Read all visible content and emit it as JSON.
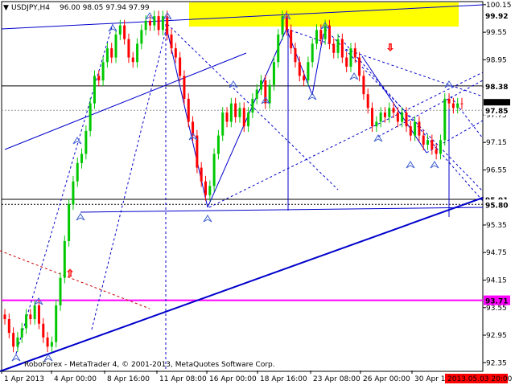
{
  "chart_data": {
    "type": "candlestick",
    "symbol_label": "USDJPY,H4",
    "ohlc_header": "96.00 98.05 97.94 97.99",
    "watermark": "RoboForex - MetaTrader 4, © 2001-2013, MetaQuotes Software Corp.",
    "ylim": [
      92.18,
      100.2
    ],
    "y_ticks": [
      100.15,
      99.55,
      98.95,
      98.35,
      97.75,
      97.15,
      96.55,
      95.95,
      95.35,
      94.75,
      94.15,
      93.55,
      92.95,
      92.35
    ],
    "x_ticks": [
      "1 Apr 2013",
      "4 Apr 00:00",
      "8 Apr 16:00",
      "11 Apr 08:00",
      "16 Apr 00:00",
      "18 Apr 16:00",
      "23 Apr 08:00",
      "26 Apr 00:00",
      "30 Apr 1"
    ],
    "last_time_label": "2013.05.03 20:00",
    "price_labels": [
      {
        "text": "99.92",
        "value": 99.92,
        "bg": "#ffffff",
        "fg": "#000000"
      },
      {
        "text": "98.38",
        "value": 98.38,
        "bg": "#ffffff",
        "fg": "#000000"
      },
      {
        "text": "97.99",
        "value": 97.99,
        "bg": "#000000",
        "fg": "#ffffff"
      },
      {
        "text": "97.85",
        "value": 97.85,
        "bg": "#ffffff",
        "fg": "#999999"
      },
      {
        "text": "95.91",
        "value": 95.91,
        "bg": "#ffffff",
        "fg": "#000000"
      },
      {
        "text": "95.80",
        "value": 95.8,
        "bg": "#ffffff",
        "fg": "#000000"
      },
      {
        "text": "93.71",
        "value": 93.71,
        "bg": "#ff00ff",
        "fg": "#ffffff"
      }
    ],
    "horizontal_levels": [
      {
        "value": 98.38,
        "color": "#000000"
      },
      {
        "value": 95.91,
        "color": "#000000"
      },
      {
        "value": 93.71,
        "color": "#ff00ff"
      }
    ],
    "colors": {
      "bull": "#00c800",
      "bear": "#ff0000",
      "trend": "#0000cc",
      "highlight": "#ffff00",
      "grid": "#dddddd"
    },
    "candles_note": "approximate close series",
    "closes": [
      93.3,
      93.0,
      92.7,
      92.9,
      93.1,
      93.4,
      93.3,
      93.6,
      93.2,
      92.9,
      92.7,
      92.8,
      93.6,
      94.2,
      95.0,
      95.8,
      96.3,
      96.7,
      96.9,
      97.4,
      98.0,
      98.6,
      98.5,
      98.9,
      99.2,
      99.0,
      99.5,
      99.7,
      99.4,
      99.0,
      98.9,
      99.3,
      99.6,
      99.8,
      99.7,
      99.9,
      99.6,
      99.9,
      99.5,
      99.2,
      99.0,
      98.6,
      98.1,
      97.6,
      97.3,
      96.6,
      96.3,
      96.0,
      96.2,
      96.9,
      97.3,
      97.8,
      97.6,
      98.0,
      97.7,
      97.9,
      97.5,
      97.8,
      98.1,
      98.3,
      98.5,
      98.0,
      98.4,
      98.9,
      99.5,
      99.9,
      99.6,
      99.2,
      98.9,
      98.6,
      98.5,
      98.9,
      99.3,
      99.6,
      99.4,
      99.7,
      99.3,
      99.1,
      99.4,
      99.0,
      98.8,
      99.2,
      99.0,
      98.6,
      98.2,
      97.9,
      97.5,
      97.6,
      97.8,
      97.7,
      97.9,
      97.8,
      97.6,
      97.8,
      97.5,
      97.3,
      97.6,
      97.3,
      97.1,
      97.2,
      97.0,
      96.9,
      97.2,
      98.1,
      98.0,
      97.9,
      98.0,
      97.99
    ]
  }
}
